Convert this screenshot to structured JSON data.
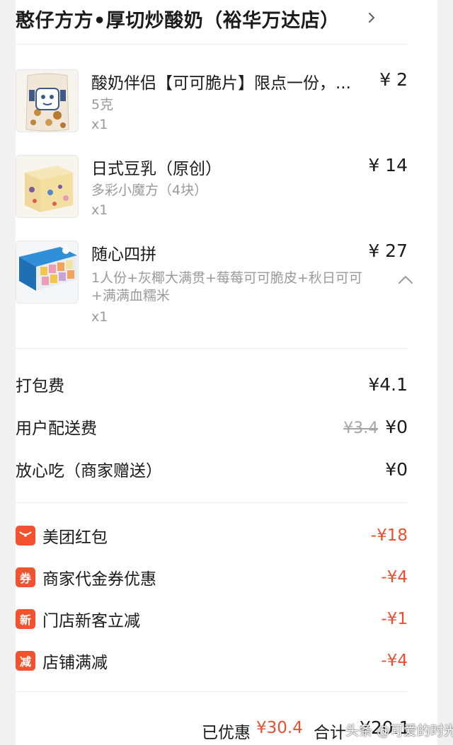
{
  "shop": {
    "name": "憨仔方方•厚切炒酸奶（裕华万达店）",
    "chevron_icon": "chevron-right-icon"
  },
  "items": [
    {
      "name": "酸奶伴侣【可可脆片】限点一份，...",
      "price": "¥ 2",
      "spec": "5克",
      "qty": "x1",
      "image": "yogurt-crisp-bag-image"
    },
    {
      "name": "日式豆乳（原创）",
      "price": "¥ 14",
      "spec": "多彩小魔方（4块）",
      "qty": "x1",
      "image": "soy-milk-cake-image"
    },
    {
      "name": "随心四拼",
      "price": "¥ 27",
      "spec": "1人份+灰椰大满贯+莓莓可可脆皮+秋日可可+满满血糯米",
      "qty": "x1",
      "image": "four-combo-box-image",
      "collapse_icon": "chevron-up-icon"
    }
  ],
  "fees": {
    "packing": {
      "label": "打包费",
      "value": "¥4.1"
    },
    "delivery": {
      "label": "用户配送费",
      "original": "¥3.4",
      "value": "¥0"
    },
    "assurance": {
      "label": "放心吃（商家赠送）",
      "value": "¥0"
    }
  },
  "discounts": [
    {
      "badge": "",
      "label": "美团红包",
      "value": "-¥18",
      "icon": "red-envelope-icon"
    },
    {
      "badge": "券",
      "label": "商家代金券优惠",
      "value": "-¥4"
    },
    {
      "badge": "新",
      "label": "门店新客立减",
      "value": "-¥1"
    },
    {
      "badge": "减",
      "label": "店铺满减",
      "value": "-¥4"
    }
  ],
  "footer": {
    "saved_label": "已优惠",
    "saved_value": "¥30.4",
    "total_label": "合计",
    "total_value": "¥20.1"
  },
  "watermark": "头条 @可爱的时光",
  "colors": {
    "accent": "#f2522e",
    "discount_text": "#e8502f",
    "secondary_text": "#9a9a9a"
  }
}
